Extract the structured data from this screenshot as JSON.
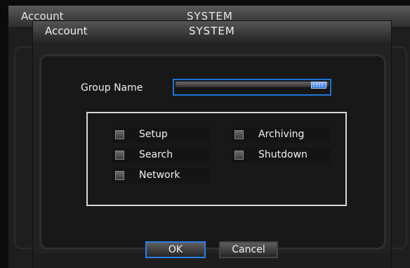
{
  "background_window": {
    "title": "Account",
    "system": "SYSTEM"
  },
  "dialog": {
    "title": "Account",
    "system": "SYSTEM",
    "group_name_label": "Group Name",
    "group_name_value": "",
    "permissions": [
      {
        "label": "Setup",
        "checked": false
      },
      {
        "label": "Archiving",
        "checked": false
      },
      {
        "label": "Search",
        "checked": false
      },
      {
        "label": "Shutdown",
        "checked": false
      },
      {
        "label": "Network",
        "checked": false
      }
    ],
    "ok_label": "OK",
    "cancel_label": "Cancel"
  },
  "colors": {
    "focus_blue": "#1d74d8",
    "panel_bg": "#181818"
  },
  "icons": {
    "keyboard": "keyboard-icon"
  }
}
